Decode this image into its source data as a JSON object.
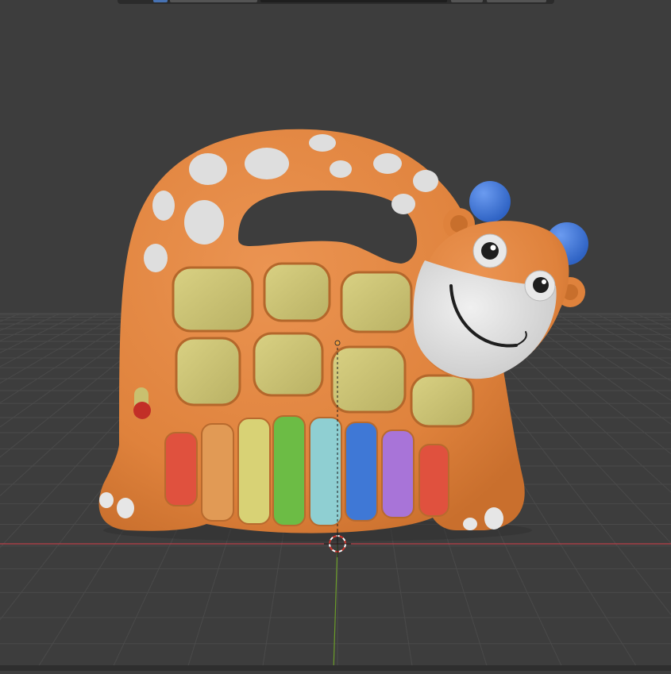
{
  "viewport": {
    "label": "3D Viewport",
    "background_color": "#3d3d3d",
    "grid_color": "#4a4a4a",
    "x_axis_color": "#b8404a",
    "y_axis_color": "#6b9c2a"
  },
  "model": {
    "name": "giraffe-toy-xylophone",
    "body_color": "#e0843e",
    "spot_color": "#dedede",
    "panel_color": "#cfc67a",
    "horn_color": "#3f78d6",
    "key_colors": [
      "#e0513e",
      "#e19a55",
      "#d8d275",
      "#6cbc45",
      "#8fcfd2",
      "#3f78d6",
      "#a874d8",
      "#e0513e"
    ]
  },
  "icons": {
    "cursor": "3d-cursor-icon",
    "origin": "object-origin-icon"
  }
}
